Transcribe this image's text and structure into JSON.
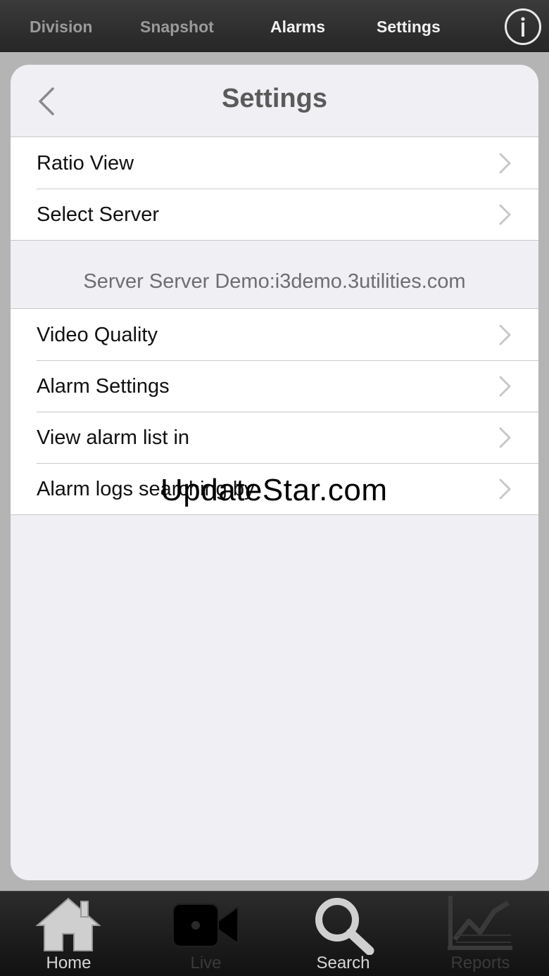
{
  "topnav": {
    "items": [
      {
        "label": "Division",
        "active": false
      },
      {
        "label": "Snapshot",
        "active": false
      },
      {
        "label": "Alarms",
        "active": true
      },
      {
        "label": "Settings",
        "active": true
      }
    ],
    "info_icon": "info-icon"
  },
  "header": {
    "title": "Settings",
    "back_icon": "chevron-left-icon"
  },
  "group1": [
    {
      "label": "Ratio View"
    },
    {
      "label": "Select Server"
    }
  ],
  "section": {
    "label": "Server Server Demo:i3demo.3utilities.com"
  },
  "group2": [
    {
      "label": "Video Quality"
    },
    {
      "label": "Alarm Settings"
    },
    {
      "label": "View alarm list in"
    },
    {
      "label": "Alarm logs searching by"
    }
  ],
  "watermark": "UpdateStar.com",
  "tabbar": {
    "tabs": [
      {
        "label": "Home",
        "icon": "home-icon"
      },
      {
        "label": "Live",
        "icon": "video-camera-icon"
      },
      {
        "label": "Search",
        "icon": "magnifier-icon"
      },
      {
        "label": "Reports",
        "icon": "chart-icon"
      }
    ]
  },
  "colors": {
    "topbar": "#2e2e2e",
    "card": "#efeff4",
    "separator": "#c8c7cc",
    "section_text": "#6d6d72"
  }
}
